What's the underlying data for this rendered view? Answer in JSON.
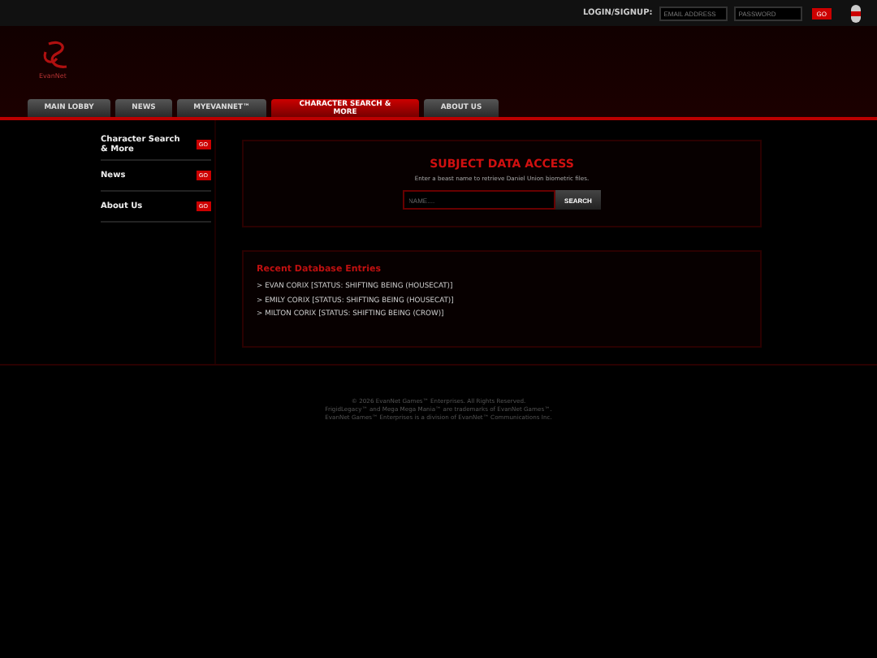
{
  "top_bar": {
    "label": "LOGIN/SIGNUP:",
    "email_placeholder": "EMAIL ADDRESS",
    "password_placeholder": "PASSWORD",
    "go": "GO"
  },
  "logo": {
    "text": "EvanNet"
  },
  "tabs": [
    {
      "label": "MAIN LOBBY",
      "selected": false
    },
    {
      "label": "NEWS",
      "selected": false
    },
    {
      "label": "MYEVANNET™",
      "selected": false
    },
    {
      "label": "CHARACTER SEARCH & MORE",
      "selected": true
    },
    {
      "label": "ABOUT US",
      "selected": false
    }
  ],
  "sidebar": {
    "items": [
      {
        "label": "Character Search & More",
        "go": "GO"
      },
      {
        "label": "News",
        "go": "GO"
      },
      {
        "label": "About Us",
        "go": "GO"
      }
    ]
  },
  "search_panel": {
    "title": "SUBJECT DATA ACCESS",
    "description": "Enter a beast name to retrieve Daniel Union biometric files.",
    "placeholder": "NAME....",
    "button": "SEARCH"
  },
  "recent": {
    "title": "Recent Database Entries",
    "entries": [
      "> EVAN CORIX [STATUS: SHIFTING BEING (HOUSECAT)]",
      "> EMILY CORIX [STATUS: SHIFTING BEING (HOUSECAT)]",
      "> MILTON CORIX [STATUS: SHIFTING BEING (CROW)]"
    ]
  },
  "footer": [
    "© 2026 EvanNet Games™ Enterprises. All Rights Reserved.",
    "FrigidLegacy™ and Mega Mega Mania™ are trademarks of EvanNet Games™.",
    "EvanNet Games™ Enterprises is a division of EvanNet™ Communications Inc."
  ]
}
